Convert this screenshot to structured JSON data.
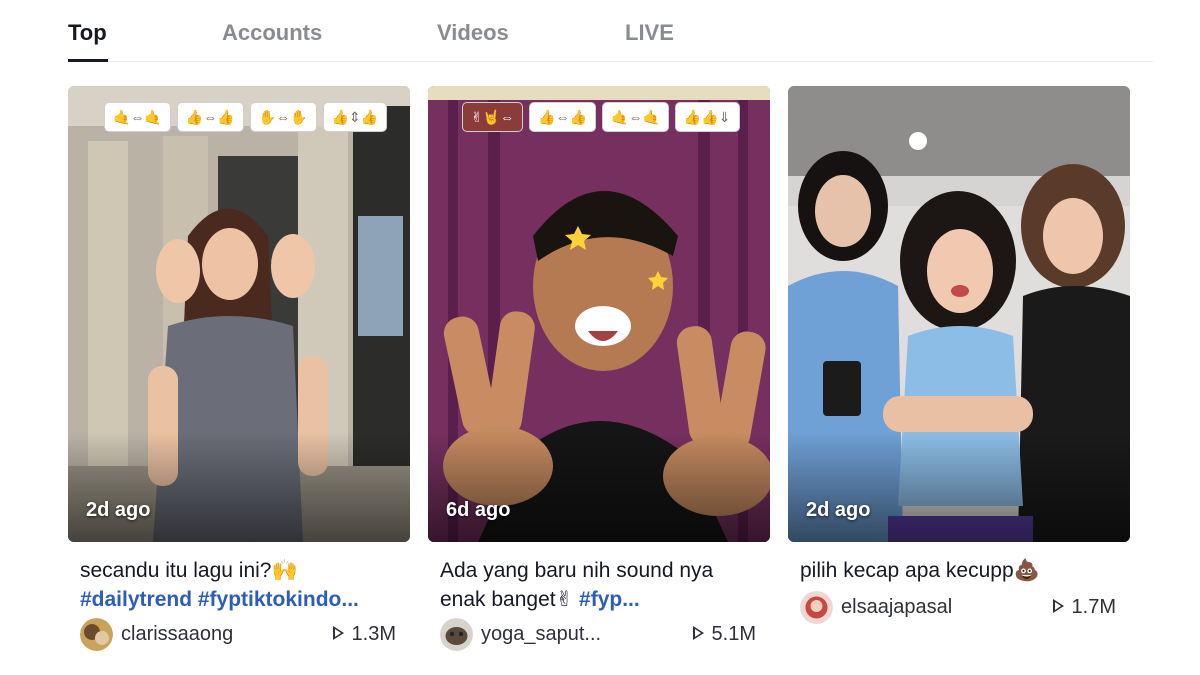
{
  "tabs": [
    {
      "label": "Top",
      "active": true
    },
    {
      "label": "Accounts",
      "active": false
    },
    {
      "label": "Videos",
      "active": false
    },
    {
      "label": "LIVE",
      "active": false
    }
  ],
  "videos": [
    {
      "ago": "2d ago",
      "caption_line1": "secandu itu lagu ini?🙌",
      "caption_line2": "#dailytrend #fyptiktokindo...",
      "username": "clarissaaong",
      "plays": "1.3M",
      "icon": "play-icon",
      "chips": [
        "🤙⇔🤙",
        "👍⇔👍",
        "✋⇔✋",
        "👍⇕👍"
      ]
    },
    {
      "ago": "6d ago",
      "caption_line1": "Ada yang baru nih sound nya",
      "caption_line2_text": "enak banget✌ ",
      "caption_line2_tag": "#fyp...",
      "username": "yoga_saput...",
      "plays": "5.1M",
      "icon": "play-icon",
      "chips": [
        "✌🤘⇔",
        "👍⇔👍",
        "🤙⇔🤙",
        "👍👍⇓"
      ]
    },
    {
      "ago": "2d ago",
      "caption_line1": "pilih kecap apa kecupp💩",
      "username": "elsaajapasal",
      "plays": "1.7M",
      "icon": "play-icon"
    }
  ],
  "colors": {
    "text": "#161823",
    "muted": "#8a8b91",
    "hashtag": "#2b5db9"
  }
}
